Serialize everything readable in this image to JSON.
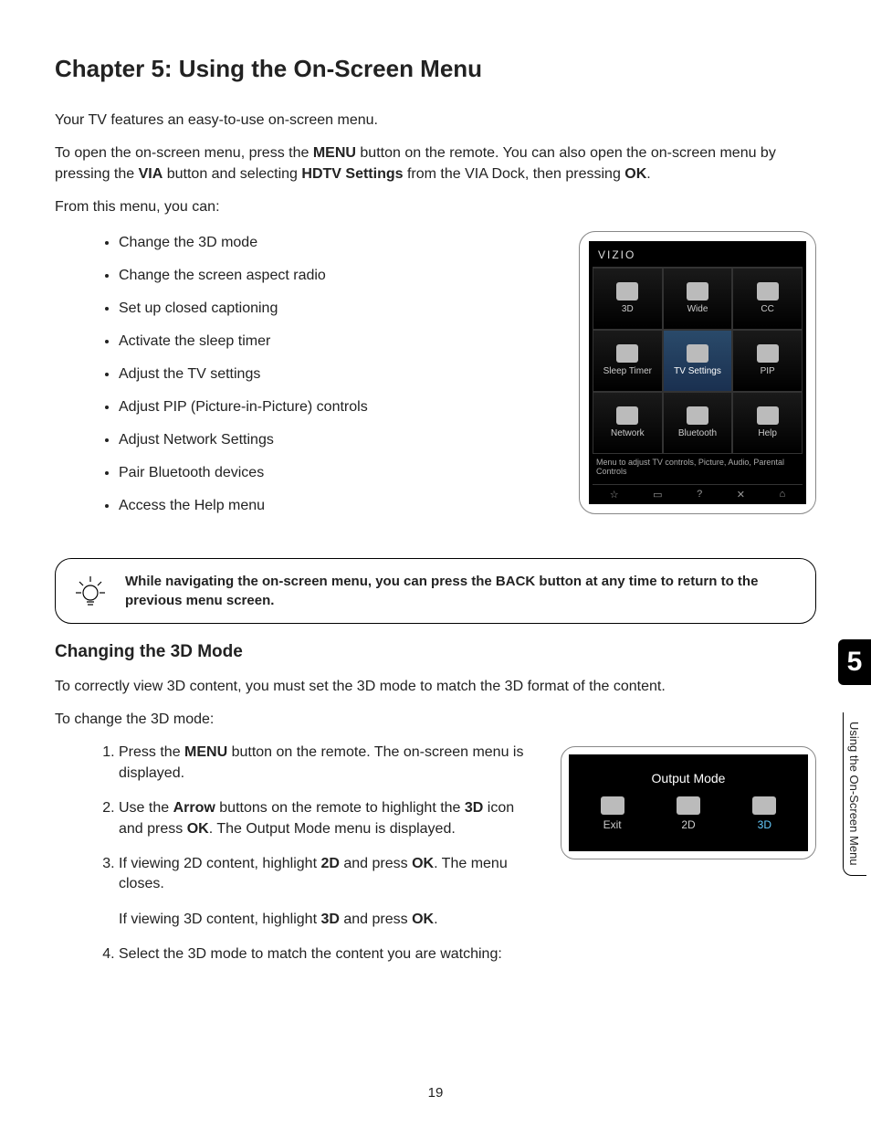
{
  "chapter_title": "Chapter 5: Using the On-Screen Menu",
  "intro_p1": "Your TV features an easy-to-use on-screen menu.",
  "intro_p2_a": "To open the on-screen menu, press the ",
  "intro_p2_menu": "MENU",
  "intro_p2_b": " button on the remote. You can also open the on-screen menu by pressing the ",
  "intro_p2_via": "VIA",
  "intro_p2_c": " button and selecting ",
  "intro_p2_hdtv": "HDTV Settings",
  "intro_p2_d": " from the VIA Dock, then pressing ",
  "intro_p2_ok": "OK",
  "intro_p2_e": ".",
  "intro_p3": "From this menu, you can:",
  "bullets": [
    "Change the 3D mode",
    "Change the screen aspect radio",
    "Set up closed captioning",
    "Activate the sleep timer",
    "Adjust the TV settings",
    "Adjust PIP (Picture-in-Picture) controls",
    "Adjust Network Settings",
    "Pair Bluetooth devices",
    "Access the Help menu"
  ],
  "vizio": {
    "logo": "VIZIO",
    "cells": [
      "3D",
      "Wide",
      "CC",
      "Sleep Timer",
      "TV Settings",
      "PIP",
      "Network",
      "Bluetooth",
      "Help"
    ],
    "caption": "Menu to adjust TV controls, Picture, Audio, Parental Controls",
    "footer_icons": [
      "☆",
      "▭",
      "?",
      "✕",
      "⌂"
    ]
  },
  "tip_text": "While navigating the on-screen menu, you can press the BACK button at any time to return to the previous menu screen.",
  "section_3d_title": "Changing the 3D Mode",
  "section_3d_p1": "To correctly view 3D content, you must set the 3D mode to match the 3D format of the content.",
  "section_3d_p2": "To change the 3D mode:",
  "steps": {
    "s1a": "Press the ",
    "s1_menu": "MENU",
    "s1b": " button on the remote. The on-screen menu is displayed.",
    "s2a": "Use the ",
    "s2_arrow": "Arrow",
    "s2b": " buttons on the remote to highlight the ",
    "s2_3d": "3D",
    "s2c": " icon and press ",
    "s2_ok": "OK",
    "s2d": ". The Output Mode menu is displayed.",
    "s3a": "If viewing 2D content, highlight ",
    "s3_2d": "2D",
    "s3b": " and press ",
    "s3_ok": "OK",
    "s3c": ". The menu closes.",
    "s3_sub_a": "If viewing 3D content, highlight ",
    "s3_sub_3d": "3D",
    "s3_sub_b": " and press ",
    "s3_sub_ok": "OK",
    "s3_sub_c": ".",
    "s4": "Select the 3D mode to match the content you are watching:"
  },
  "output_mode": {
    "title": "Output Mode",
    "cells": [
      "Exit",
      "2D",
      "3D"
    ]
  },
  "side_tab": {
    "num": "5",
    "label": "Using the On-Screen Menu"
  },
  "page_num": "19"
}
